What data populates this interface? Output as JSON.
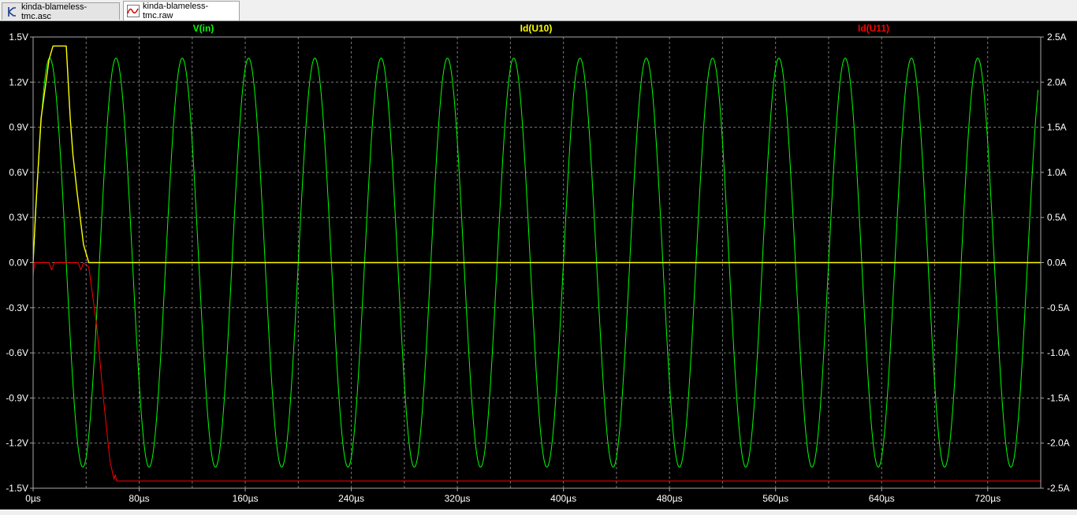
{
  "tabs": [
    {
      "label": "kinda-blameless-tmc.asc",
      "icon": "schematic-icon",
      "active": false
    },
    {
      "label": "kinda-blameless-tmc.raw",
      "icon": "waveform-icon",
      "active": true
    }
  ],
  "chart_data": {
    "type": "line",
    "background": "#000000",
    "grid": true,
    "x": {
      "min": 0,
      "max": 760,
      "unit": "µs",
      "ticks": [
        "0µs",
        "80µs",
        "160µs",
        "240µs",
        "320µs",
        "400µs",
        "480µs",
        "560µs",
        "640µs",
        "720µs"
      ]
    },
    "y_left": {
      "min": -1.5,
      "max": 1.5,
      "unit": "V",
      "ticks": [
        "1.5V",
        "1.2V",
        "0.9V",
        "0.6V",
        "0.3V",
        "0.0V",
        "-0.3V",
        "-0.6V",
        "-0.9V",
        "-1.2V",
        "-1.5V"
      ]
    },
    "y_right": {
      "min": -2.5,
      "max": 2.5,
      "unit": "A",
      "ticks": [
        "2.5A",
        "2.0A",
        "1.5A",
        "1.0A",
        "0.5A",
        "0.0A",
        "-0.5A",
        "-1.0A",
        "-1.5A",
        "-2.0A",
        "-2.5A"
      ]
    },
    "series": [
      {
        "name": "V(in)",
        "color": "#00ff00",
        "axis": "left",
        "kind": "sine",
        "amplitude": 1.36,
        "period_us": 50,
        "phase_start_us": 0
      },
      {
        "name": "Id(U10)",
        "color": "#ffff00",
        "axis": "right",
        "points": [
          [
            0,
            0
          ],
          [
            2,
            0.6
          ],
          [
            6,
            1.6
          ],
          [
            12,
            2.25
          ],
          [
            15,
            2.4
          ],
          [
            25,
            2.4
          ],
          [
            28,
            1.6
          ],
          [
            30,
            1.2
          ],
          [
            33,
            0.8
          ],
          [
            38,
            0.2
          ],
          [
            42,
            0
          ],
          [
            760,
            0
          ]
        ]
      },
      {
        "name": "Id(U11)",
        "color": "#ff0000",
        "axis": "right",
        "points": [
          [
            0,
            -0.15
          ],
          [
            1,
            0
          ],
          [
            12,
            0
          ],
          [
            14,
            -0.08
          ],
          [
            16,
            0
          ],
          [
            34,
            0
          ],
          [
            36,
            -0.08
          ],
          [
            38,
            0
          ],
          [
            42,
            -0.05
          ],
          [
            48,
            -0.7
          ],
          [
            53,
            -1.5
          ],
          [
            58,
            -2.2
          ],
          [
            61,
            -2.4
          ],
          [
            62,
            -2.35
          ],
          [
            63,
            -2.42
          ],
          [
            760,
            -2.42
          ]
        ]
      }
    ]
  }
}
